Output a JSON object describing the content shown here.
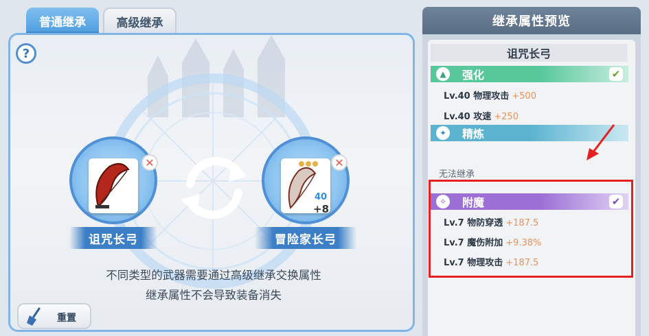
{
  "tabs": [
    {
      "label": "普通继承",
      "active": true
    },
    {
      "label": "高级继承",
      "active": false
    }
  ],
  "help_label": "?",
  "left_weapon": {
    "name": "诅咒长弓",
    "remove_icon": "close-icon"
  },
  "right_weapon": {
    "name": "冒险家长弓",
    "level": "40",
    "plus": "+8",
    "remove_icon": "close-icon"
  },
  "hint_lines": [
    "不同类型的武器需要通过高级继承交换属性",
    "继承属性不会导致装备消失"
  ],
  "reset_label": "重置",
  "preview": {
    "title": "继承属性预览",
    "weapon_name": "诅咒长弓",
    "enhance": {
      "label": "强化",
      "color": "#58c79a",
      "checked": true,
      "stats": [
        {
          "name": "Lv.40 物理攻击",
          "value": "+500"
        },
        {
          "name": "Lv.40 攻速",
          "value": "+250"
        }
      ]
    },
    "refine": {
      "label": "精炼",
      "color": "#5bb3d0",
      "note": "无法继承"
    },
    "enchant": {
      "label": "附魔",
      "color": "#9b6fd6",
      "checked": true,
      "stats": [
        {
          "name": "Lv.7 物防穿透",
          "value": "+187.5"
        },
        {
          "name": "Lv.7 魔伤附加",
          "value": "+9.38%"
        },
        {
          "name": "Lv.7 物理攻击",
          "value": "+187.5"
        }
      ]
    }
  },
  "colors": {
    "accent": "#4e9ede",
    "highlight_box": "#e62020",
    "stat_value": "#e8925a"
  }
}
